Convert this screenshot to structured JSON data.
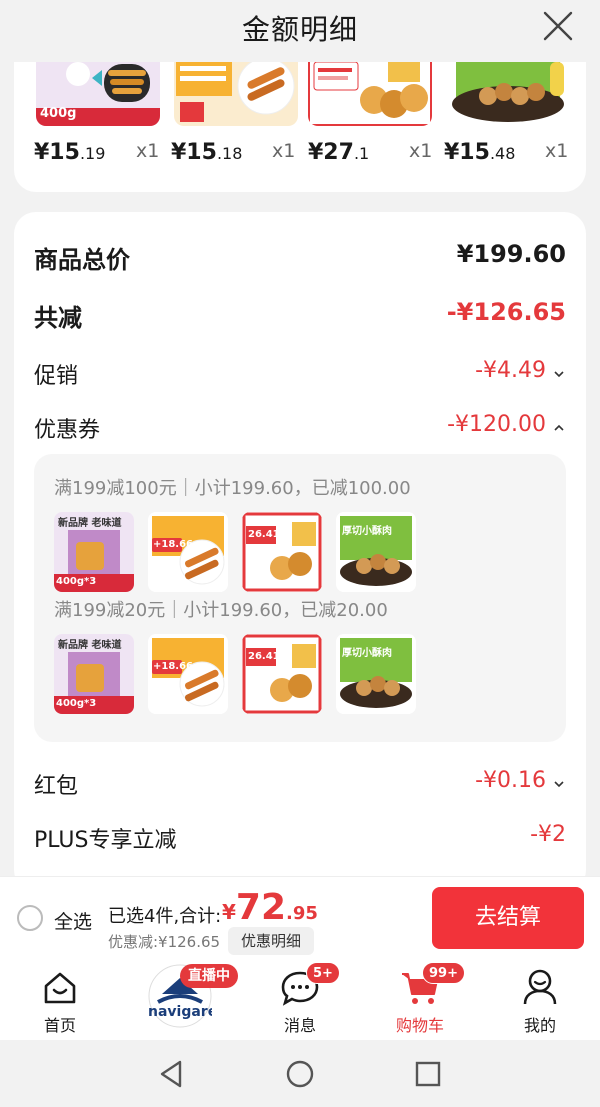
{
  "header": {
    "title": "金额明细"
  },
  "products": [
    {
      "price_int": "¥15",
      "price_dec": ".19",
      "qty": "x1"
    },
    {
      "price_int": "¥15",
      "price_dec": ".18",
      "qty": "x1"
    },
    {
      "price_int": "¥27",
      "price_dec": ".1",
      "qty": "x1"
    },
    {
      "price_int": "¥15",
      "price_dec": ".48",
      "qty": "x1"
    }
  ],
  "product_thumb_text": {
    "p1_weight": "400g"
  },
  "details": {
    "total_label": "商品总价",
    "total_value": "¥199.60",
    "reduce_label": "共减",
    "reduce_value": "-¥126.65",
    "promo_label": "促销",
    "promo_value": "-¥4.49",
    "coupon_label": "优惠券",
    "coupon_value": "-¥120.00",
    "coupon_lines": [
      "满199减100元｜小计199.60，已减100.00",
      "满199减20元｜小计199.60，已减20.00"
    ],
    "redpacket_label": "红包",
    "redpacket_value": "-¥0.16",
    "plus_label": "PLUS专享立减",
    "plus_value": "-¥2"
  },
  "thumb_text": {
    "brand": "新品牌 老味道",
    "weight": "400g*3",
    "tag1": "+18.66",
    "tag2": "26.41",
    "tag3": "厚切小酥肉"
  },
  "checkout": {
    "select_all": "全选",
    "selected_text": "已选4件,合计:",
    "total_sym": "¥",
    "total_int": "72",
    "total_dec": ".95",
    "saved": "优惠减:¥126.65",
    "detail_btn": "优惠明细",
    "checkout_btn": "去结算"
  },
  "tabbar": {
    "live_badge": "直播中",
    "items": [
      {
        "label": "首页"
      },
      {
        "label": "navigare"
      },
      {
        "label": "消息",
        "badge": "5+"
      },
      {
        "label": "购物车",
        "badge": "99+"
      },
      {
        "label": "我的"
      }
    ]
  },
  "colors": {
    "accent": "#e4393c",
    "button": "#f2333a"
  }
}
